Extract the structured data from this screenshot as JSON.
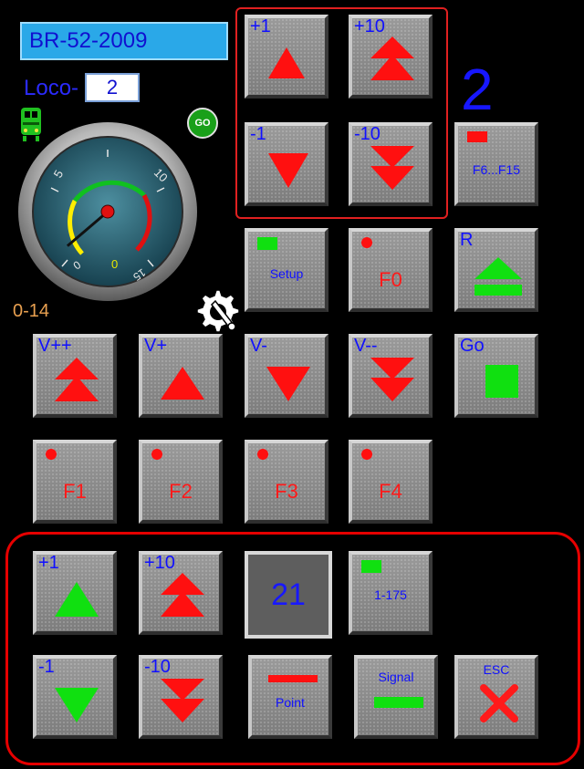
{
  "header": {
    "loco_name": "BR-52-2009",
    "loco_label": "Loco-",
    "loco_address": "2",
    "current_value": "2",
    "speed_range": "0-14",
    "go_badge": "GO"
  },
  "gauge": {
    "tick_labels": [
      "5",
      "10",
      "0",
      "0",
      "15"
    ],
    "needle_value_fraction": 0.05
  },
  "top_block": {
    "plus1": "+1",
    "plus10": "+10",
    "minus1": "-1",
    "minus10": "-10",
    "functions_range": "F6...F15"
  },
  "row_setup": {
    "setup": "Setup",
    "f0": "F0",
    "reverse": "R"
  },
  "speed_row": {
    "vpp": "V++",
    "vp": "V+",
    "vm": "V-",
    "vmm": "V--",
    "go": "Go"
  },
  "functions": [
    "F1",
    "F2",
    "F3",
    "F4"
  ],
  "bottom_block": {
    "plus1": "+1",
    "plus10": "+10",
    "display_value": "21",
    "range": "1-175",
    "minus1": "-1",
    "minus10": "-10",
    "point": "Point",
    "signal": "Signal",
    "esc": "ESC"
  },
  "colors": {
    "accent_blue": "#1010ff",
    "arrow_red": "#ff1010",
    "arrow_green": "#10e010",
    "frame_red": "#e60000"
  }
}
